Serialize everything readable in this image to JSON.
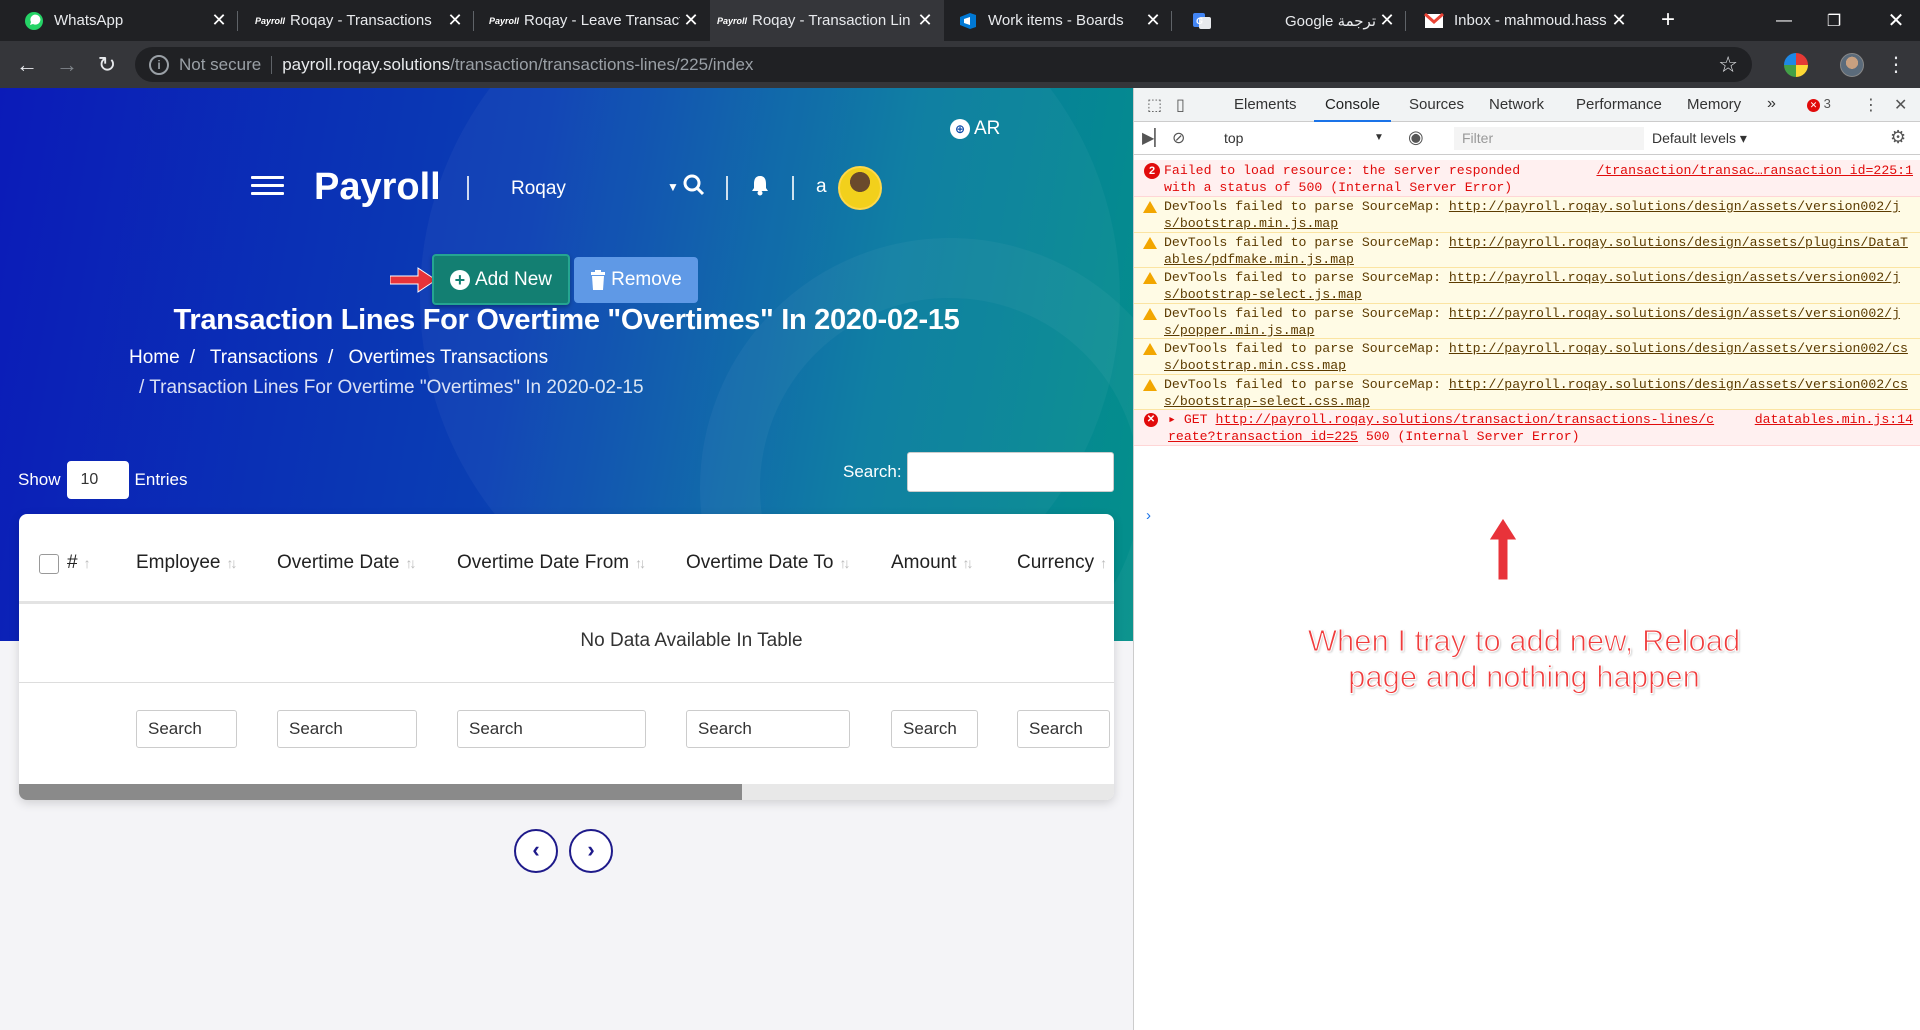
{
  "browser": {
    "tabs": [
      {
        "title": "WhatsApp",
        "favicon": "whatsapp-icon",
        "active": false
      },
      {
        "title": "Roqay - Transactions",
        "favicon": "payroll-icon",
        "active": false
      },
      {
        "title": "Roqay - Leave Transact",
        "favicon": "payroll-icon",
        "active": false
      },
      {
        "title": "Roqay - Transaction Lin",
        "favicon": "payroll-icon",
        "active": true
      },
      {
        "title": "Work items - Boards",
        "favicon": "azure-devops-icon",
        "active": false
      },
      {
        "title": "Google ترجمة",
        "favicon": "google-translate-icon",
        "active": false
      },
      {
        "title": "Inbox - mahmoud.hass",
        "favicon": "gmail-icon",
        "active": false
      }
    ],
    "address": {
      "security": "Not secure",
      "host": "payroll.roqay.solutions",
      "path": "/transaction/transactions-lines/225/index"
    }
  },
  "app": {
    "language_toggle": "AR",
    "brand": "Payroll",
    "company": "Roqay",
    "user_initial": "a",
    "add_new_label": "Add New",
    "remove_label": "Remove",
    "page_title": "Transaction Lines For Overtime \"Overtimes\" In 2020-02-15",
    "breadcrumb": [
      "Home",
      "Transactions",
      "Overtimes Transactions"
    ],
    "breadcrumb_current": "Transaction Lines For Overtime \"Overtimes\" In 2020-02-15",
    "length": {
      "show_label": "Show",
      "value": "10",
      "entries_label": "Entries"
    },
    "search_label": "Search:",
    "table": {
      "columns": [
        "#",
        "Employee",
        "Overtime Date",
        "Overtime Date From",
        "Overtime Date To",
        "Amount",
        "Currency"
      ],
      "empty_message": "No Data Available In Table",
      "column_search_placeholder": "Search"
    },
    "pager": {
      "prev": "‹",
      "next": "›"
    }
  },
  "devtools": {
    "tabs": [
      "Elements",
      "Console",
      "Sources",
      "Network",
      "Performance",
      "Memory"
    ],
    "active_tab": "Console",
    "error_count": "3",
    "context": "top",
    "filter_placeholder": "Filter",
    "levels": "Default levels",
    "messages": [
      {
        "level": "error",
        "count": "2",
        "text": "Failed to load resource: the server responded with a status of 500 (Internal Server Error)",
        "source": "/transaction/transac…ransaction_id=225:1"
      },
      {
        "level": "warning",
        "text": "DevTools failed to parse SourceMap:",
        "url": "http://payroll.roqay.solutions/design/assets/version002/js/bootstrap.min.js.map"
      },
      {
        "level": "warning",
        "text": "DevTools failed to parse SourceMap:",
        "url": "http://payroll.roqay.solutions/design/assets/plugins/DataTables/pdfmake.min.js.map"
      },
      {
        "level": "warning",
        "text": "DevTools failed to parse SourceMap:",
        "url": "http://payroll.roqay.solutions/design/assets/version002/js/bootstrap-select.js.map"
      },
      {
        "level": "warning",
        "text": "DevTools failed to parse SourceMap:",
        "url": "http://payroll.roqay.solutions/design/assets/version002/js/popper.min.js.map"
      },
      {
        "level": "warning",
        "text": "DevTools failed to parse SourceMap:",
        "url": "http://payroll.roqay.solutions/design/assets/version002/css/bootstrap.min.css.map"
      },
      {
        "level": "warning",
        "text": "DevTools failed to parse SourceMap:",
        "url": "http://payroll.roqay.solutions/design/assets/version002/css/bootstrap-select.css.map"
      },
      {
        "level": "error",
        "text": "GET",
        "url": "http://payroll.roqay.solutions/transaction/transactions-lines/create?transaction_id=225",
        "status": "500 (Internal Server Error)",
        "source": "datatables.min.js:14"
      }
    ]
  },
  "annotation": {
    "text": "When I tray to add new, Reload page and nothing happen",
    "color": "#f03c3c"
  }
}
